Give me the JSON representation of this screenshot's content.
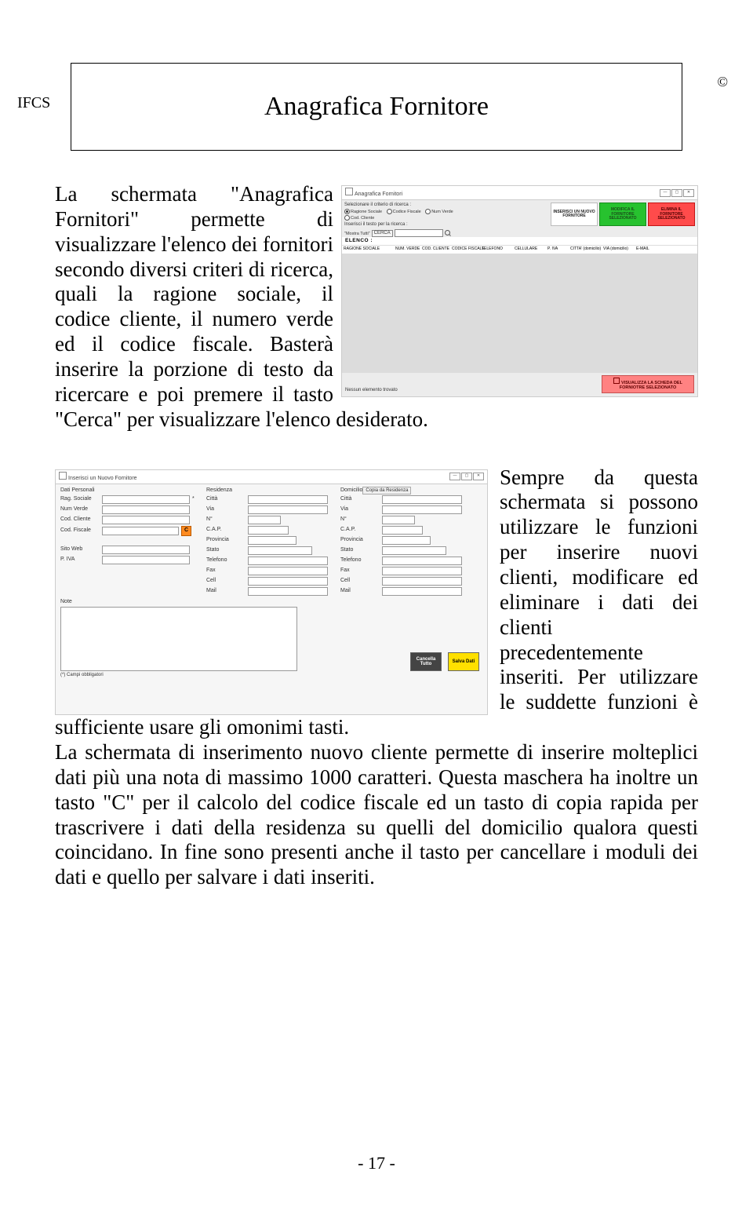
{
  "header": {
    "mark": "IFCS",
    "copyright": "©"
  },
  "title": "Anagrafica Fornitore",
  "para1": "La schermata \"Anagrafica Fornitori\" permette di visualizzare l'elenco dei fornitori secondo diversi criteri di ricerca, quali la ragione sociale, il codice cliente, il numero verde ed il codice fiscale. Basterà inserire la porzione di testo da ricercare e poi premere il tasto \"Cerca\" per visualizzare l'elenco desiderato.",
  "para2_side": "Sempre da questa schermata si possono utilizzare le funzioni per inserire nuovi clienti, modificare ed eliminare i dati dei clienti precedentemente inseriti. Per utilizzare le suddette funzioni è sufficiente usare gli omonimi tasti.",
  "para2_full": "La schermata di inserimento nuovo cliente permette di inserire molteplici dati più una nota di massimo 1000 caratteri. Questa maschera ha inoltre un tasto \"C\" per il calcolo del codice fiscale ed un tasto di copia rapida per trascrivere i dati della residenza su quelli del domicilio qualora questi coincidano. In fine sono presenti anche il tasto per cancellare i moduli dei dati e quello per salvare i dati inseriti.",
  "page_number": "- 17 -",
  "win1": {
    "title": "Anagrafica Fornitori",
    "search_label": "Selezionare il criterio di ricerca :",
    "radios": [
      "Ragione Sociale",
      "Codice Fiscale",
      "Num Verde",
      "Cod. Cliente"
    ],
    "search_text_label": "Inserisci il testo per la ricerca :",
    "mostra": "\"Mostra Tutti\"",
    "cerca": "CERCA",
    "big_buttons": {
      "insert": "INSERISCI UN NUOVO FORNITORE",
      "modify": "MODIFICA IL FORNITORE SELEZIONATO",
      "delete": "ELIMINA IL FORNITORE SELEZIONATO"
    },
    "elenco": "ELENCO :",
    "cols": [
      "RAGIONE SOCIALE",
      "NUM. VERDE",
      "COD. CLIENTE",
      "CODICE FISCALE",
      "TELEFONO",
      "CELLULARE",
      "P. IVA",
      "CITTA' (domicilio)",
      "VIA (domicilio)",
      "E-MAIL"
    ],
    "empty": "Nessun elemento trovato",
    "view_btn": "VISUALIZZA LA SCHEDA DEL FORNIOTRE SELEZIONATO"
  },
  "win2": {
    "title": "Inserisci un Nuovo Fornitore",
    "groups": {
      "personali": "Dati Personali",
      "residenza": "Residenza",
      "domicilio": "Domicilio"
    },
    "copy_btn": "Copia da Residenza",
    "labels_p": [
      "Rag. Sociale",
      "Num Verde",
      "Cod. Cliente",
      "Cod. Fiscale",
      "Sito Web",
      "P. IVA"
    ],
    "labels_r": [
      "Città",
      "Via",
      "N°",
      "C.A.P.",
      "Provincia",
      "Stato",
      "Telefono",
      "Fax",
      "Cell",
      "Mail"
    ],
    "labels_d": [
      "Città",
      "Via",
      "N°",
      "C.A.P.",
      "Provincia",
      "Stato",
      "Telefono",
      "Fax",
      "Cell",
      "Mail"
    ],
    "c_btn": "C",
    "note": "Note",
    "req": "(*) Campi obbligatori",
    "cancel": "Cancella Tutto",
    "save": "Salva Dati"
  }
}
